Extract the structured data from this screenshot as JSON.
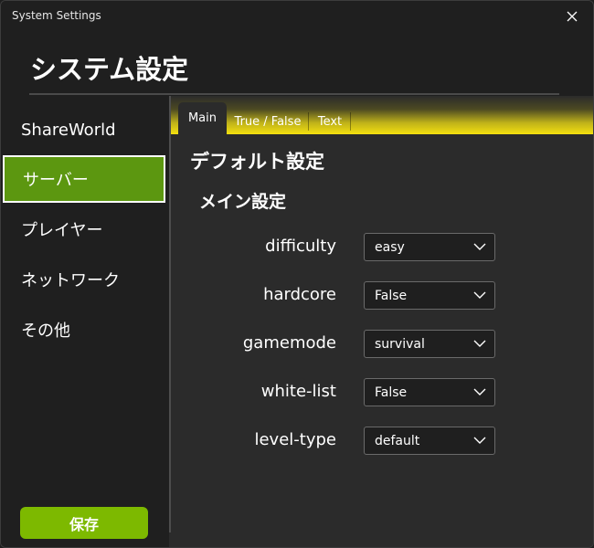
{
  "window": {
    "title": "System Settings",
    "close_icon": "close-icon"
  },
  "header": {
    "title": "システム設定"
  },
  "sidebar": {
    "items": [
      {
        "label": "ShareWorld",
        "active": false
      },
      {
        "label": "サーバー",
        "active": true
      },
      {
        "label": "プレイヤー",
        "active": false
      },
      {
        "label": "ネットワーク",
        "active": false
      },
      {
        "label": "その他",
        "active": false
      }
    ],
    "save_label": "保存"
  },
  "tabs": [
    {
      "label": "Main",
      "active": true
    },
    {
      "label": "True / False",
      "active": false
    },
    {
      "label": "Text",
      "active": false
    }
  ],
  "main": {
    "heading": "デフォルト設定",
    "subheading": "メイン設定",
    "settings": [
      {
        "label": "difficulty",
        "value": "easy"
      },
      {
        "label": "hardcore",
        "value": "False"
      },
      {
        "label": "gamemode",
        "value": "survival"
      },
      {
        "label": "white-list",
        "value": "False"
      },
      {
        "label": "level-type",
        "value": "default"
      }
    ]
  },
  "colors": {
    "accent_green": "#7db900",
    "active_nav": "#5c9710",
    "tab_strip_yellow": "#f4e00f",
    "background": "#2b2b2b"
  }
}
